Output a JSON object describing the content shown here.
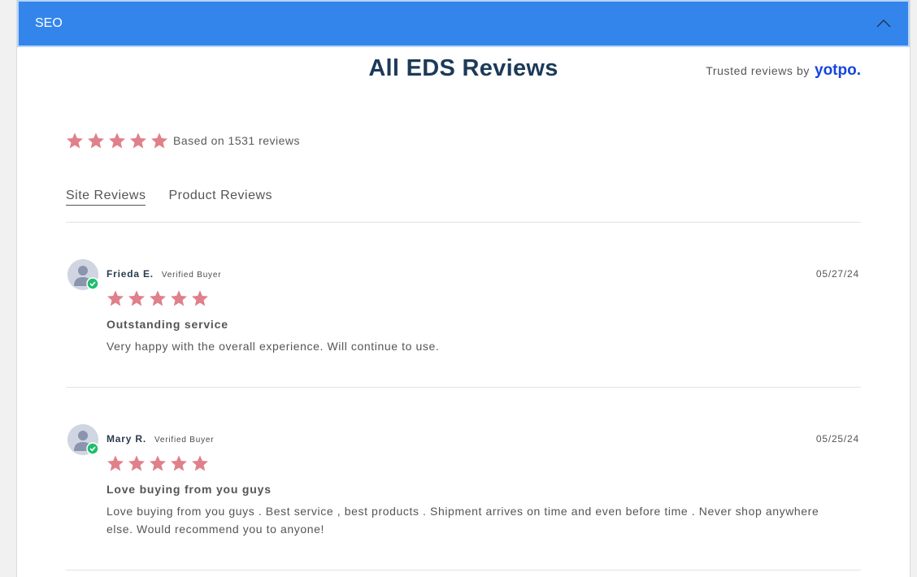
{
  "seo_bar": {
    "label": "SEO",
    "icon": "chevron-up-icon"
  },
  "widget": {
    "title": "All EDS Reviews",
    "trusted_prefix": "Trusted reviews by",
    "brand": "yotpo."
  },
  "summary": {
    "rating": 5,
    "text": "Based on 1531 reviews"
  },
  "tabs": [
    {
      "label": "Site Reviews",
      "active": true
    },
    {
      "label": "Product Reviews",
      "active": false
    }
  ],
  "reviews": [
    {
      "name": "Frieda E.",
      "badge": "Verified Buyer",
      "date": "05/27/24",
      "rating": 5,
      "title": "Outstanding service",
      "body": "Very happy with the overall experience. Will continue to use."
    },
    {
      "name": "Mary R.",
      "badge": "Verified Buyer",
      "date": "05/25/24",
      "rating": 5,
      "title": "Love buying from you guys",
      "body": "Love buying from you guys . Best service , best products . Shipment arrives on time and even before time . Never shop anywhere else. Would recommend you to anyone!"
    }
  ],
  "colors": {
    "seo_bar": "#3385ec",
    "star": "#e0808a",
    "title": "#1c3a59",
    "brand": "#1446e0",
    "verified_check": "#1ebe6e"
  }
}
